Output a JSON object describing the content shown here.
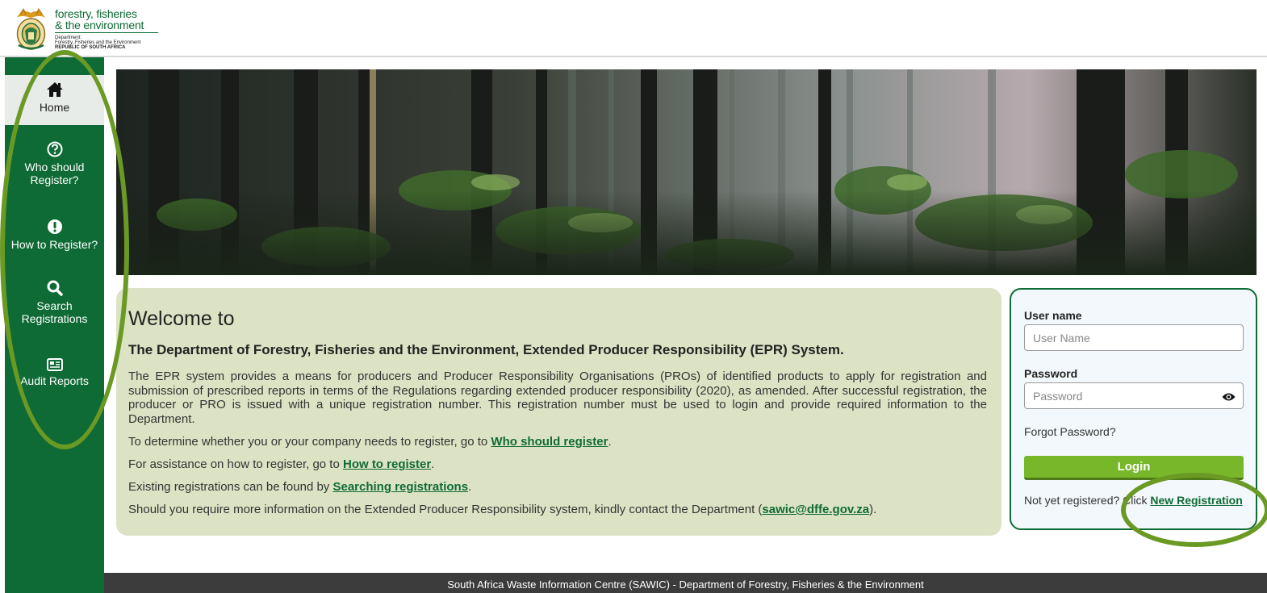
{
  "header": {
    "logo_line1": "forestry, fisheries",
    "logo_line2": "& the environment",
    "logo_small1": "Department:",
    "logo_small2": "Forestry, Fisheries and the Environment",
    "logo_small3": "REPUBLIC OF SOUTH AFRICA"
  },
  "sidebar": {
    "items": [
      {
        "label": "Home",
        "icon": "home-icon",
        "active": true
      },
      {
        "label": "Who should Register?",
        "icon": "question-circle-icon",
        "active": false
      },
      {
        "label": "How to Register?",
        "icon": "exclamation-circle-icon",
        "active": false
      },
      {
        "label": "Search Registrations",
        "icon": "search-icon",
        "active": false
      },
      {
        "label": "Audit Reports",
        "icon": "newspaper-icon",
        "active": false
      }
    ]
  },
  "welcome": {
    "title": "Welcome to",
    "subtitle": "The Department of Forestry, Fisheries and the Environment, Extended Producer Responsibility (EPR) System.",
    "paragraph": "The EPR system provides a means for producers and Producer Responsibility Organisations (PROs) of identified products to apply for registration and submission of prescribed reports in terms of the Regulations regarding extended producer responsibility (2020), as amended. After successful registration, the producer or PRO is issued with a unique registration number. This registration number must be used to login and provide required information to the Department.",
    "line1_prefix": "To determine whether you or your company needs to register, go to ",
    "line1_link": "Who should register",
    "line1_suffix": ".",
    "line2_prefix": "For assistance on how to register, go to ",
    "line2_link": "How to register",
    "line2_suffix": ".",
    "line3_prefix": "Existing registrations can be found by ",
    "line3_link": "Searching registrations",
    "line3_suffix": ".",
    "line4_prefix": "Should you require more information on the Extended Producer Responsibility system, kindly contact the Department (",
    "line4_link": "sawic@dffe.gov.za",
    "line4_suffix": ")."
  },
  "login": {
    "username_label": "User name",
    "username_placeholder": "User Name",
    "username_value": "",
    "password_label": "Password",
    "password_placeholder": "Password",
    "password_value": "",
    "forgot": "Forgot Password?",
    "button": "Login",
    "not_registered": "Not yet registered? Click ",
    "new_registration": "New Registration"
  },
  "footer": {
    "text": "South Africa Waste Information Centre (SAWIC) - Department of Forestry, Fisheries & the Environment"
  },
  "colors": {
    "brand_green": "#0f6b35",
    "accent_green": "#78b72a",
    "panel_bg": "#dce3c5",
    "annotation": "#6a9a24"
  }
}
